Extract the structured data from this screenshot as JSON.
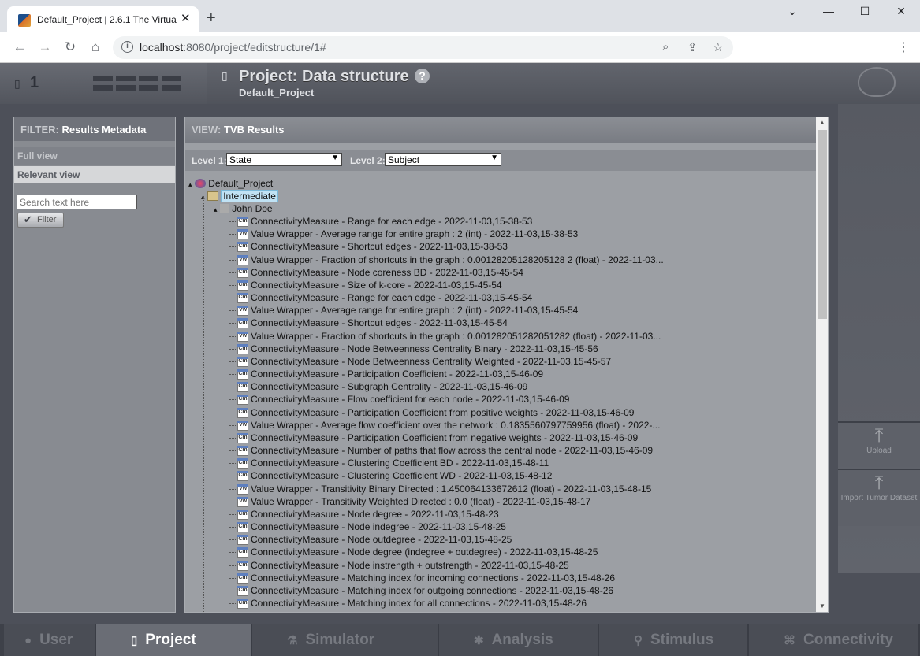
{
  "browser": {
    "tab_title": "Default_Project | 2.6.1 The Virtual",
    "tab_close": "✕",
    "new_tab": "+",
    "url_host": "localhost",
    "url_rest": ":8080/project/editstructure/1#"
  },
  "header": {
    "project_number": "1",
    "title": "Project: Data structure",
    "help": "?",
    "subtitle": "Default_Project"
  },
  "filter": {
    "label": "FILTER:",
    "value": "Results Metadata",
    "views": [
      {
        "label": "Full view",
        "active": false
      },
      {
        "label": "Relevant view",
        "active": true
      }
    ],
    "search_placeholder": "Search text here",
    "button": "Filter"
  },
  "view": {
    "label": "VIEW:",
    "value": "TVB Results",
    "level1_label": "Level 1:",
    "level1_value": "State",
    "level2_label": "Level 2:",
    "level2_value": "Subject"
  },
  "tree": {
    "root": "Default_Project",
    "folder": "Intermediate",
    "subject": "John Doe",
    "items": [
      {
        "type": "Cm",
        "text": "ConnectivityMeasure - Range for each edge - 2022-11-03,15-38-53"
      },
      {
        "type": "Vw",
        "text": "Value Wrapper - Average range for entire graph : 2 (int) - 2022-11-03,15-38-53"
      },
      {
        "type": "Cm",
        "text": "ConnectivityMeasure - Shortcut edges - 2022-11-03,15-38-53"
      },
      {
        "type": "Vw",
        "text": "Value Wrapper - Fraction of shortcuts in the graph : 0.00128205128205128 2 (float) - 2022-11-03..."
      },
      {
        "type": "Cm",
        "text": "ConnectivityMeasure - Node coreness BD - 2022-11-03,15-45-54"
      },
      {
        "type": "Cm",
        "text": "ConnectivityMeasure - Size of k-core - 2022-11-03,15-45-54"
      },
      {
        "type": "Cm",
        "text": "ConnectivityMeasure - Range for each edge - 2022-11-03,15-45-54"
      },
      {
        "type": "Vw",
        "text": "Value Wrapper - Average range for entire graph : 2 (int) - 2022-11-03,15-45-54"
      },
      {
        "type": "Cm",
        "text": "ConnectivityMeasure - Shortcut edges - 2022-11-03,15-45-54"
      },
      {
        "type": "Vw",
        "text": "Value Wrapper - Fraction of shortcuts in the graph : 0.001282051282051282 (float) - 2022-11-03..."
      },
      {
        "type": "Cm",
        "text": "ConnectivityMeasure - Node Betweenness Centrality Binary - 2022-11-03,15-45-56"
      },
      {
        "type": "Cm",
        "text": "ConnectivityMeasure - Node Betweenness Centrality Weighted - 2022-11-03,15-45-57"
      },
      {
        "type": "Cm",
        "text": "ConnectivityMeasure - Participation Coefficient - 2022-11-03,15-46-09"
      },
      {
        "type": "Cm",
        "text": "ConnectivityMeasure - Subgraph Centrality - 2022-11-03,15-46-09"
      },
      {
        "type": "Cm",
        "text": "ConnectivityMeasure - Flow coefficient for each node - 2022-11-03,15-46-09"
      },
      {
        "type": "Cm",
        "text": "ConnectivityMeasure - Participation Coefficient from positive weights - 2022-11-03,15-46-09"
      },
      {
        "type": "Vw",
        "text": "Value Wrapper - Average flow coefficient over the network : 0.1835560797759956 (float) - 2022-..."
      },
      {
        "type": "Cm",
        "text": "ConnectivityMeasure - Participation Coefficient from negative weights - 2022-11-03,15-46-09"
      },
      {
        "type": "Cm",
        "text": "ConnectivityMeasure - Number of paths that flow across the central node - 2022-11-03,15-46-09"
      },
      {
        "type": "Cm",
        "text": "ConnectivityMeasure - Clustering Coefficient BD - 2022-11-03,15-48-11"
      },
      {
        "type": "Cm",
        "text": "ConnectivityMeasure - Clustering Coefficient WD - 2022-11-03,15-48-12"
      },
      {
        "type": "Vw",
        "text": "Value Wrapper - Transitivity Binary Directed : 1.450064133672612 (float) - 2022-11-03,15-48-15"
      },
      {
        "type": "Vw",
        "text": "Value Wrapper - Transitivity Weighted Directed : 0.0 (float) - 2022-11-03,15-48-17"
      },
      {
        "type": "Cm",
        "text": "ConnectivityMeasure - Node degree - 2022-11-03,15-48-23"
      },
      {
        "type": "Cm",
        "text": "ConnectivityMeasure - Node indegree - 2022-11-03,15-48-25"
      },
      {
        "type": "Cm",
        "text": "ConnectivityMeasure - Node outdegree - 2022-11-03,15-48-25"
      },
      {
        "type": "Cm",
        "text": "ConnectivityMeasure - Node degree (indegree + outdegree) - 2022-11-03,15-48-25"
      },
      {
        "type": "Cm",
        "text": "ConnectivityMeasure - Node instrength + outstrength - 2022-11-03,15-48-25"
      },
      {
        "type": "Cm",
        "text": "ConnectivityMeasure - Matching index for incoming connections - 2022-11-03,15-48-26"
      },
      {
        "type": "Cm",
        "text": "ConnectivityMeasure - Matching index for outgoing connections - 2022-11-03,15-48-26"
      },
      {
        "type": "Cm",
        "text": "ConnectivityMeasure - Matching index for all connections - 2022-11-03,15-48-26"
      }
    ]
  },
  "right_actions": [
    {
      "label": "Upload"
    },
    {
      "label": "Import Tumor Dataset"
    }
  ],
  "bottom_nav": [
    {
      "label": "User",
      "icon": "user-icon",
      "active": false
    },
    {
      "label": "Project",
      "icon": "document-icon",
      "active": true
    },
    {
      "label": "Simulator",
      "icon": "flask-icon",
      "active": false
    },
    {
      "label": "Analysis",
      "icon": "gear-icon",
      "active": false
    },
    {
      "label": "Stimulus",
      "icon": "pin-icon",
      "active": false
    },
    {
      "label": "Connectivity",
      "icon": "network-icon",
      "active": false
    }
  ]
}
